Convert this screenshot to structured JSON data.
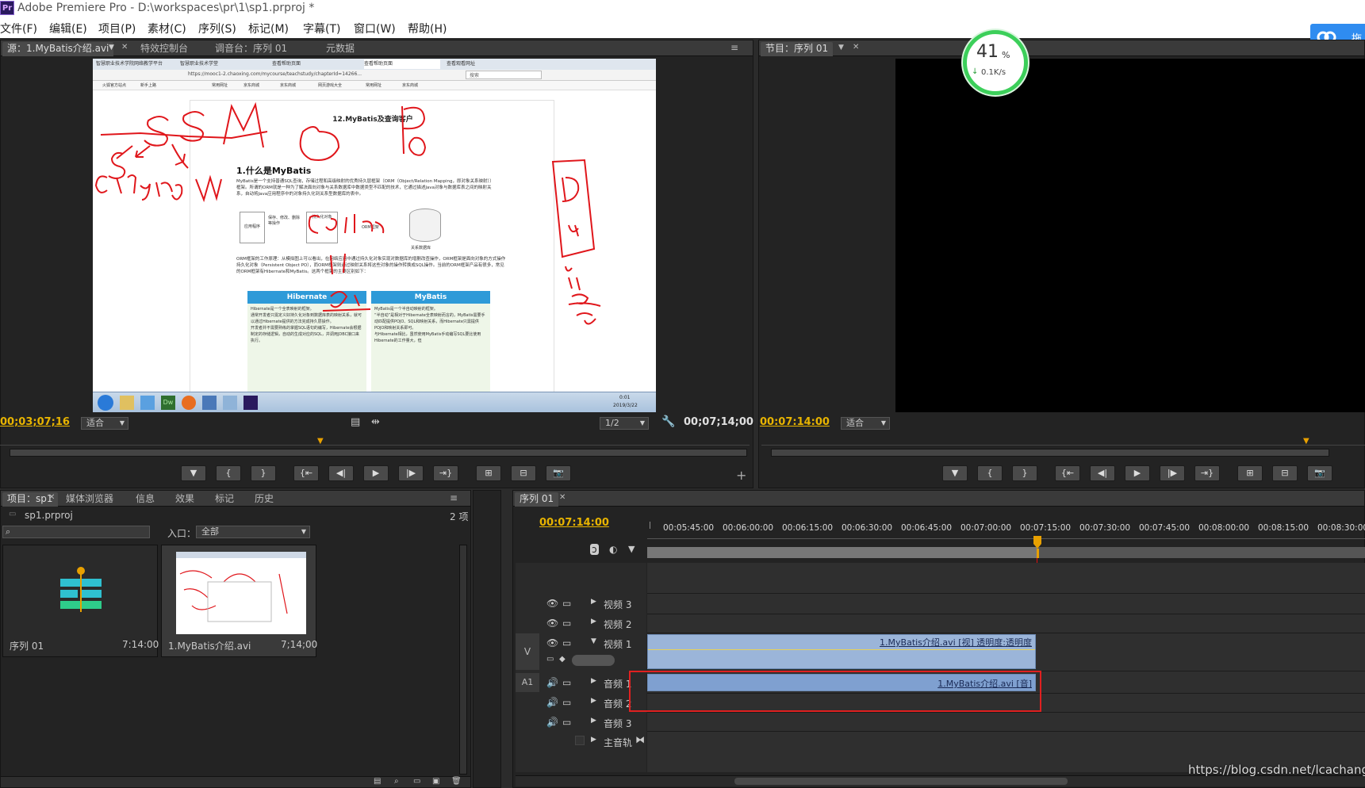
{
  "window": {
    "app_logo": "Pr",
    "title": "Adobe Premiere Pro - D:\\workspaces\\pr\\1\\sp1.prproj *"
  },
  "menu": [
    "文件(F)",
    "编辑(E)",
    "项目(P)",
    "素材(C)",
    "序列(S)",
    "标记(M)",
    "字幕(T)",
    "窗口(W)",
    "帮助(H)"
  ],
  "cloud_button": {
    "label": "拖"
  },
  "network_widget": {
    "percent": "41",
    "percent_sign": "%",
    "speed": "0.1K/s"
  },
  "source_panel": {
    "tabs": [
      "源：1.MyBatis介绍.avi",
      "特效控制台",
      "调音台：序列 01",
      "元数据"
    ],
    "timecode": "00;03;07;16",
    "fit_label": "适合",
    "page_select": "1/2",
    "duration": "00;07;14;00",
    "screen": {
      "browser_tabs": [
        "智慧职业技术学院网络教学平台",
        "智慧职业技术学堂",
        "查看帮助页面",
        "查看帮助页面",
        "查看观看网址"
      ],
      "url": "https://mooc1-2.chaoxing.com/mycourse/teachstudy/chapterId=14266...",
      "search_placeholder": "搜索",
      "bookmarks": [
        "火狐官方站点",
        "新手上路",
        "常用网址",
        "京东商城",
        "京东商城",
        "网页游戏大全",
        "常用网址",
        "京东商城"
      ],
      "page_heading": "12.MyBatis及查询客户",
      "section_title": "1.什么是MyBatis",
      "paragraph1": "MyBatis是一个支持普通SQL查询，存储过程和高级映射的优秀持久层框架（ORM（Object/Relation Mapping，即对象关系映射））框架。所谓的ORM就是一种为了解决面向对象与关系数据库中数据类型不匹配的技术，它通过描述Java对象与数据库表之间的映射关系，自动将Java应用程序中的对象持久化到关系型数据库的表中。",
      "diagram_labels": [
        "应用程序",
        "保存、修改、删除等操作",
        "持久化对象",
        "ORM框架",
        "关系数据库"
      ],
      "paragraph2": "ORM框架的工作原理：从模拟图上可以看出，在网络应用中通过持久化对象实现对数据库的增删改查操作，ORM框架是面向对象的方式操作持久化对象（Persistent Object PO），而ORM框架则通过映射关系将这些对象的操作转换成SQL操作。当前的ORM框架产品有很多，常见的ORM框架有Hibernate和MyBatis。这两个框架的主要区别如下：",
      "hibernate": {
        "title": "Hibernate",
        "items": [
          "Hibernate是一个全表映射的框架。",
          "通常开发者只需定义好持久化对象到数据库表的映射关系，就可以通过Hibernate提供的方法完成持久层操作。",
          "开发者并不需要熟练的掌握SQL语句的编写，Hibernate会根据制定的存储逻辑，自动的生成对应的SQL，并调用JDBC接口来执行。"
        ]
      },
      "mybatis": {
        "title": "MyBatis",
        "items": [
          "MyBatis是一个半自动映射的框架。",
          "“半自动”是相对于Hibernate全表映射而言的，MyBatis需要手动匹配提供POJO、SQL和映射关系，而Hibernate只需提供POJO和映射关系即可。",
          "与Hibernate相比，虽然使用MyBatis手动编写SQL要比使用Hibernate的工作量大，但"
        ]
      },
      "taskbar_time": "0:01",
      "taskbar_date": "2019/3/22",
      "annotations": [
        "SSM",
        "Spring",
        "MVC",
        "Po",
        "Domain"
      ]
    }
  },
  "program_panel": {
    "tab": "节目：序列 01",
    "timecode": "00:07:14:00",
    "fit_label": "适合"
  },
  "project_panel": {
    "tabs": [
      "项目：sp1",
      "媒体浏览器",
      "信息",
      "效果",
      "标记",
      "历史"
    ],
    "project_file": "sp1.prproj",
    "item_count": "2 项",
    "in_label": "入口：",
    "in_value": "全部",
    "items": [
      {
        "name": "序列 01",
        "duration": "7:14:00"
      },
      {
        "name": "1.MyBatis介绍.avi",
        "duration": "7;14;00"
      }
    ]
  },
  "timeline": {
    "tab": "序列 01",
    "timecode": "00:07:14:00",
    "ruler": [
      "00:05:45:00",
      "00:06:00:00",
      "00:06:15:00",
      "00:06:30:00",
      "00:06:45:00",
      "00:07:00:00",
      "00:07:15:00",
      "00:07:30:00",
      "00:07:45:00",
      "00:08:00:00",
      "00:08:15:00",
      "00:08:30:00"
    ],
    "video_tracks": [
      "视频 3",
      "视频 2",
      "视频 1"
    ],
    "audio_tracks": [
      "音频 1",
      "音频 2",
      "音频 3"
    ],
    "master_track": "主音轨",
    "v_target": "V",
    "a_target": "A1",
    "video_clip": "1.MyBatis介绍.avi [视] 透明度:透明度",
    "audio_clip": "1.MyBatis介绍.avi [音]",
    "playhead_pct": 0.604
  },
  "watermark": "https://blog.csdn.net/lcachang",
  "colors": {
    "timecode": "#e8b400",
    "clip_video": "#9bb5d9",
    "clip_audio": "#7fa0d0",
    "highlight_box": "#e02020",
    "cloud_blue": "#2f8cf0"
  }
}
